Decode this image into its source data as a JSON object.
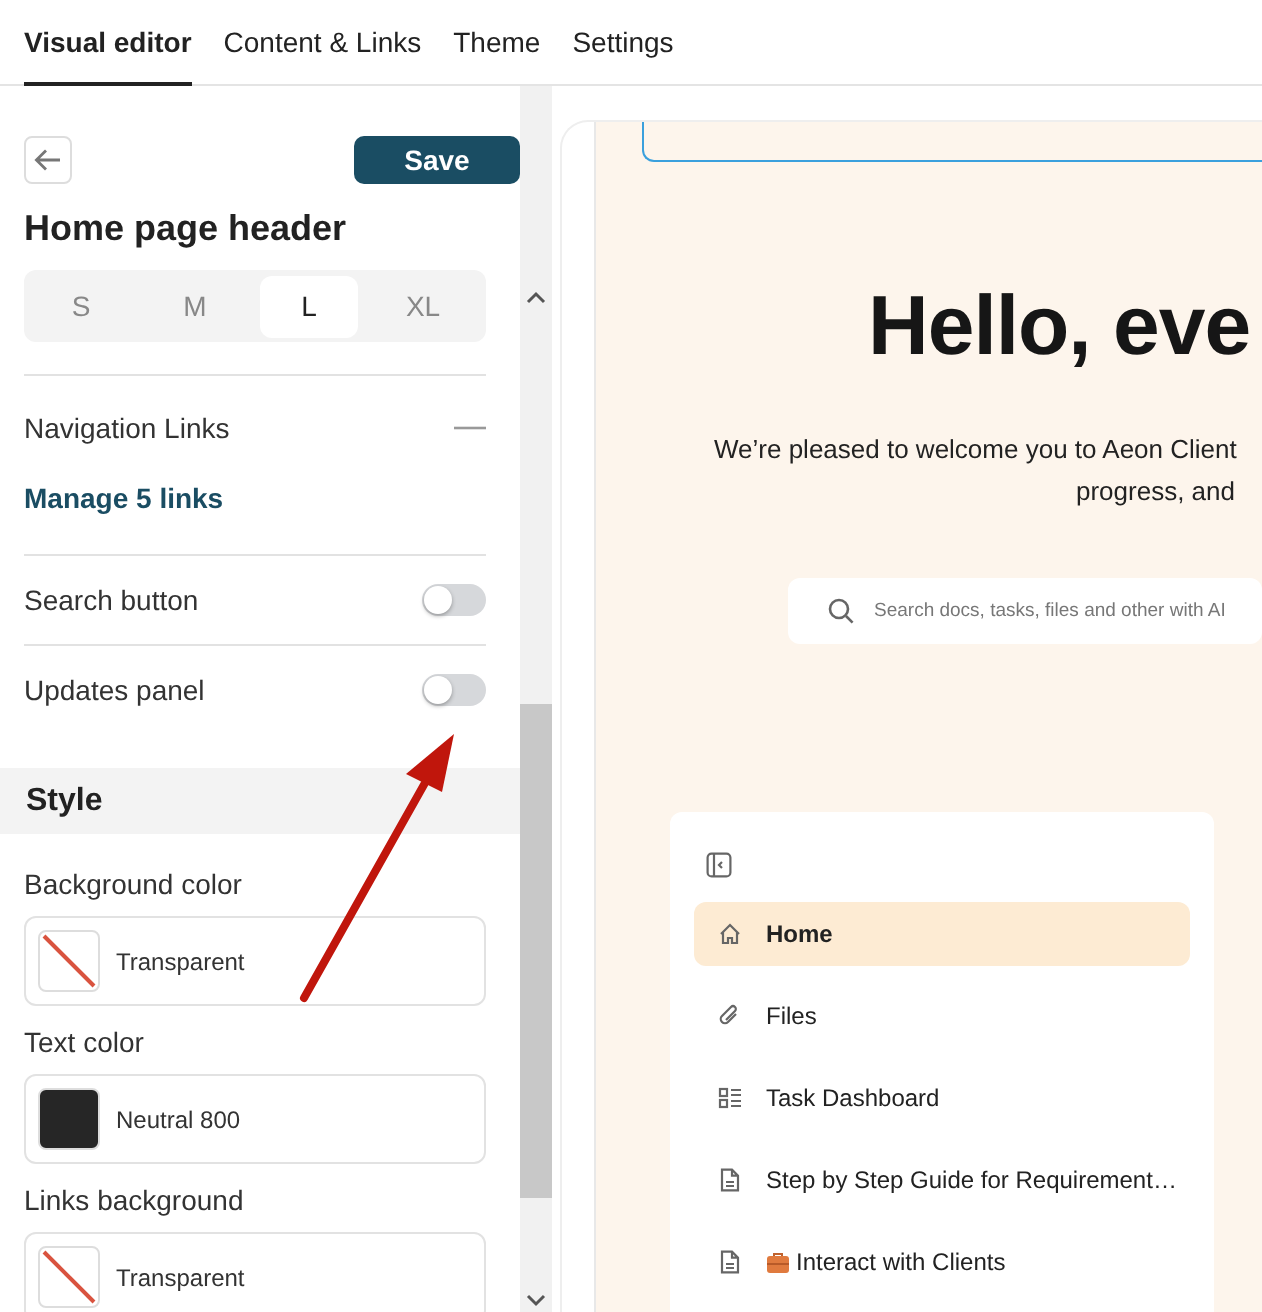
{
  "tabs": [
    {
      "label": "Visual editor",
      "selected": true
    },
    {
      "label": "Content & Links",
      "selected": false
    },
    {
      "label": "Theme",
      "selected": false
    },
    {
      "label": "Settings",
      "selected": false
    }
  ],
  "editor": {
    "save": "Save",
    "title": "Home page header",
    "sizes": [
      {
        "label": "S",
        "selected": false
      },
      {
        "label": "M",
        "selected": false
      },
      {
        "label": "L",
        "selected": true
      },
      {
        "label": "XL",
        "selected": false
      }
    ],
    "navigation": {
      "label": "Navigation Links",
      "expanded": true,
      "link": "Manage 5 links"
    },
    "toggles": [
      {
        "label": "Search button",
        "on": false
      },
      {
        "label": "Updates panel",
        "on": false
      }
    ],
    "style": {
      "title": "Style",
      "colors": [
        {
          "label": "Background color",
          "value": "Transparent",
          "kind": "transparent"
        },
        {
          "label": "Text color",
          "value": "Neutral 800",
          "kind": "solid",
          "color": "#262626"
        },
        {
          "label": "Links background",
          "value": "Transparent",
          "kind": "transparent"
        }
      ]
    }
  },
  "preview": {
    "heading": "Hello, eve",
    "intro": [
      "We’re pleased to welcome you to Aeon Client",
      "progress, and"
    ],
    "search": {
      "placeholder": "Search docs, tasks, files and other with AI"
    },
    "nav_items": [
      {
        "label": "Home",
        "kind": "home",
        "selected": true
      },
      {
        "label": "Files",
        "kind": "attachment",
        "selected": false
      },
      {
        "label": "Task Dashboard",
        "kind": "list",
        "selected": false
      },
      {
        "label": "Step by Step Guide for Requirement…",
        "kind": "document",
        "selected": false
      },
      {
        "label": "Interact with Clients",
        "kind": "briefcase",
        "selected": false
      }
    ]
  }
}
